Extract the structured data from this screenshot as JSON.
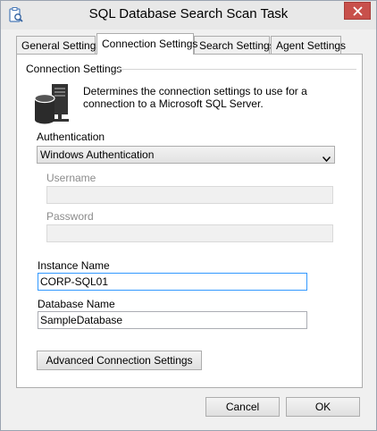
{
  "window": {
    "title": "SQL Database Search Scan Task"
  },
  "tabs": [
    {
      "label": "General Settings"
    },
    {
      "label": "Connection Settings"
    },
    {
      "label": "Search Settings"
    },
    {
      "label": "Agent Settings"
    }
  ],
  "panel": {
    "group_title": "Connection Settings",
    "description": "Determines the connection settings to use for a connection to a Microsoft SQL Server.",
    "authentication": {
      "label": "Authentication",
      "selected": "Windows Authentication"
    },
    "username": {
      "label": "Username",
      "value": ""
    },
    "password": {
      "label": "Password",
      "value": ""
    },
    "instance": {
      "label": "Instance Name",
      "value": "CORP-SQL01"
    },
    "database": {
      "label": "Database Name",
      "value": "SampleDatabase"
    },
    "advanced_button": "Advanced Connection Settings"
  },
  "footer": {
    "cancel": "Cancel",
    "ok": "OK"
  },
  "colors": {
    "focus_border": "#3399ff",
    "close_button": "#c8504b"
  },
  "icons": {
    "app": "scan-task-icon",
    "close": "close-icon",
    "database": "database-server-icon",
    "dropdown": "chevron-down-icon"
  }
}
